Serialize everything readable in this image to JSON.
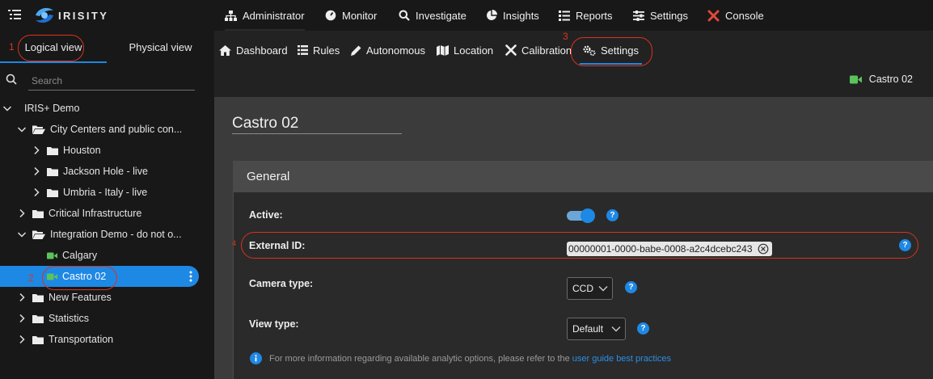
{
  "brand": {
    "name": "IRISITY"
  },
  "sidebar": {
    "tabs": {
      "logical": "Logical view",
      "physical": "Physical view"
    },
    "search_placeholder": "Search",
    "tree": [
      {
        "label": "IRIS+ Demo",
        "level": 0,
        "expanded": true,
        "type": "root"
      },
      {
        "label": "City Centers and public con...",
        "level": 1,
        "expanded": true,
        "type": "folder-open"
      },
      {
        "label": "Houston",
        "level": 2,
        "expanded": false,
        "type": "folder"
      },
      {
        "label": "Jackson Hole - live",
        "level": 2,
        "expanded": false,
        "type": "folder"
      },
      {
        "label": "Umbria - Italy - live",
        "level": 2,
        "expanded": false,
        "type": "folder"
      },
      {
        "label": "Critical Infrastructure",
        "level": 1,
        "expanded": false,
        "type": "folder"
      },
      {
        "label": "Integration Demo - do not o...",
        "level": 1,
        "expanded": true,
        "type": "folder-open"
      },
      {
        "label": "Calgary",
        "level": 2,
        "type": "camera"
      },
      {
        "label": "Castro 02",
        "level": 2,
        "type": "camera",
        "selected": true
      },
      {
        "label": "New Features",
        "level": 1,
        "expanded": false,
        "type": "folder"
      },
      {
        "label": "Statistics",
        "level": 1,
        "expanded": false,
        "type": "folder"
      },
      {
        "label": "Transportation",
        "level": 1,
        "expanded": false,
        "type": "folder"
      }
    ]
  },
  "topnav": {
    "administrator": "Administrator",
    "monitor": "Monitor",
    "investigate": "Investigate",
    "insights": "Insights",
    "reports": "Reports",
    "settings": "Settings",
    "console": "Console"
  },
  "subnav": {
    "dashboard": "Dashboard",
    "rules": "Rules",
    "autonomous": "Autonomous",
    "location": "Location",
    "calibration": "Calibration",
    "settings": "Settings",
    "camera_name": "Castro 02"
  },
  "main": {
    "camera_title": "Castro 02",
    "panel_title": "General",
    "active_label": "Active:",
    "active_value": true,
    "external_id_label": "External ID:",
    "external_id_value": "00000001-0000-babe-0008-a2c4dcebc243",
    "camera_type_label": "Camera type:",
    "camera_type_value": "CCD",
    "view_type_label": "View type:",
    "view_type_value": "Default",
    "help": "?",
    "info_text": "For more information regarding available analytic options, please refer to the",
    "info_link": "user guide best practices"
  },
  "annotations": {
    "n1": "1",
    "n2": "2",
    "n3": "3",
    "n4": "4"
  },
  "colors": {
    "accent": "#1e88e5",
    "annotation": "#d8321c",
    "camera_icon": "#5cc35c",
    "console_icon": "#e0483a"
  }
}
